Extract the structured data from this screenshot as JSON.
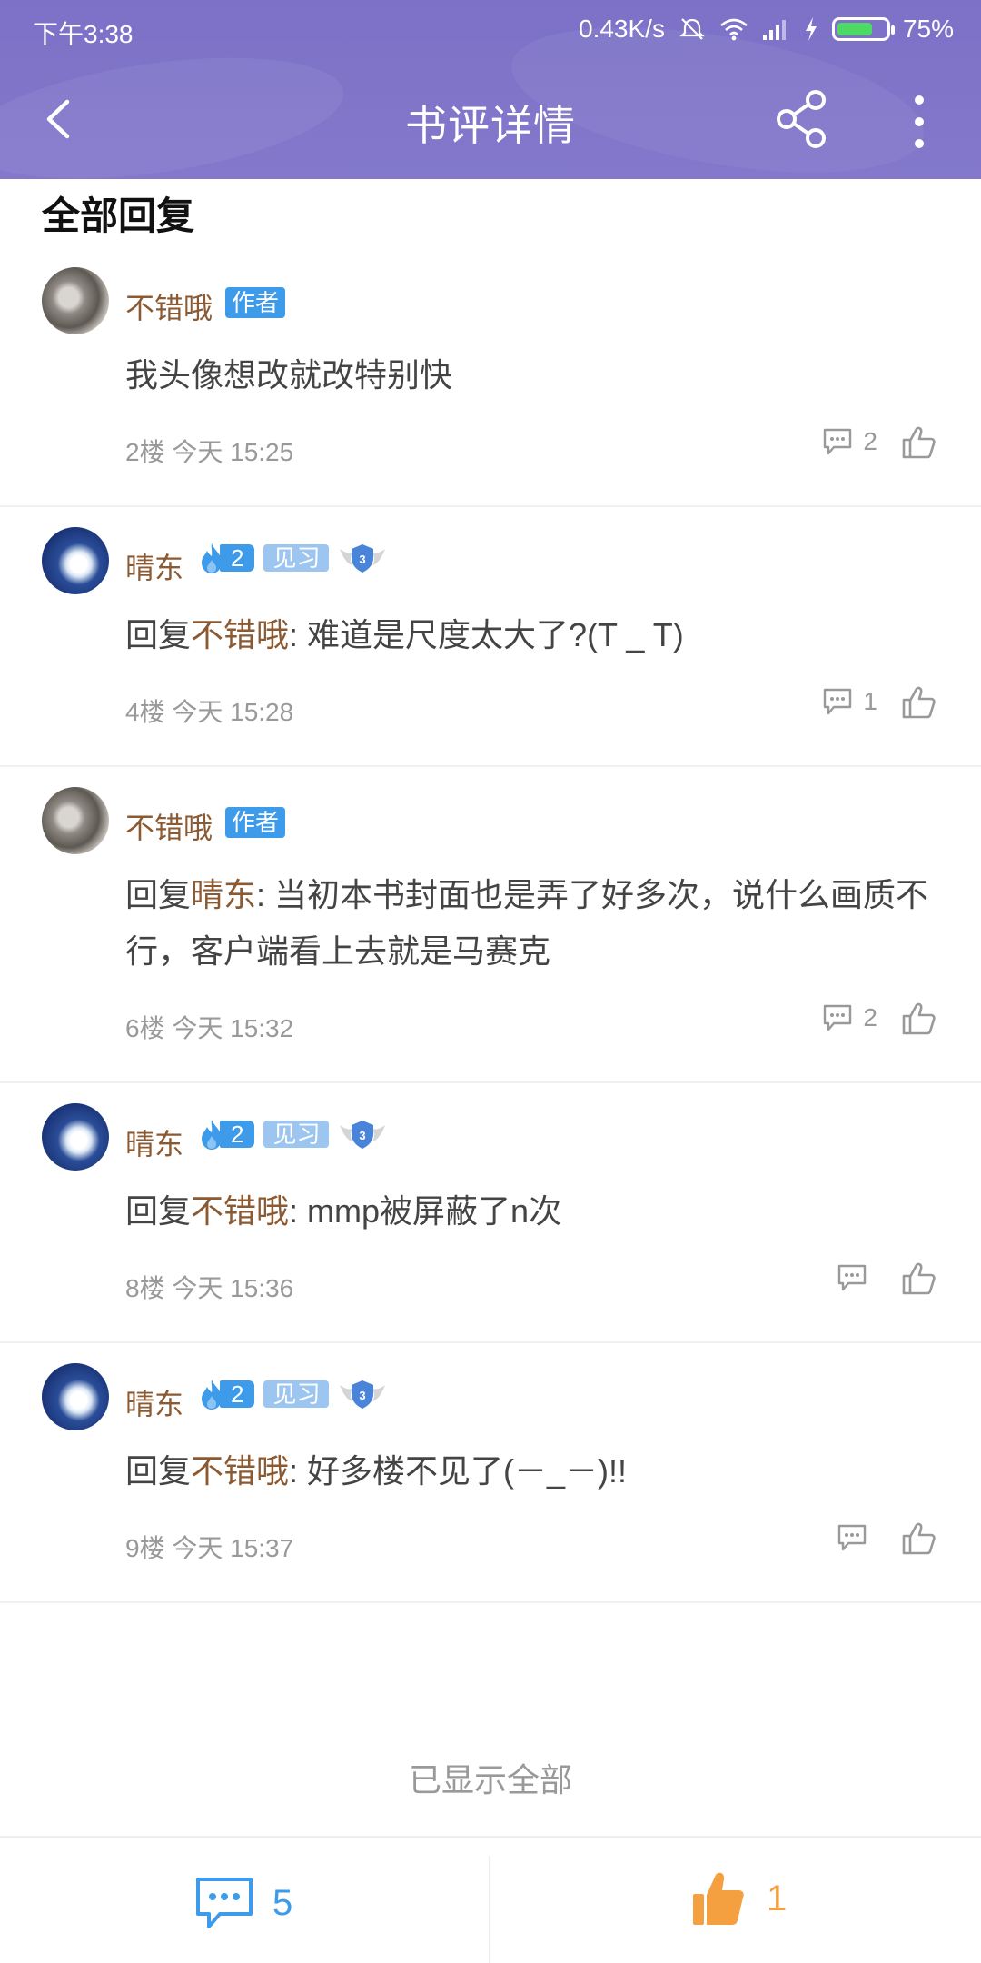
{
  "status_bar": {
    "time": "下午3:38",
    "net_speed": "0.43K/s",
    "battery": "75%",
    "battery_level": 0.75
  },
  "nav": {
    "title": "书评详情",
    "back_icon": "chevron-left-icon",
    "share_icon": "share-icon",
    "more_icon": "more-vertical-icon"
  },
  "section_title": "全部回复",
  "author_badge": "作者",
  "fire_level": "2",
  "jx_label": "见习",
  "shield_level": "3",
  "comments": [
    {
      "user": "不错哦",
      "is_author": true,
      "reply_prefix": "",
      "reply_to": "",
      "reply_colon": "",
      "text": "我头像想改就改特别快",
      "floor": "2楼 今天 15:25",
      "reply_count": "2"
    },
    {
      "user": "晴东",
      "is_author": false,
      "reply_prefix": "回复",
      "reply_to": "不错哦",
      "reply_colon": ": ",
      "text": "难道是尺度太大了?(T _ T)",
      "floor": "4楼 今天 15:28",
      "reply_count": "1"
    },
    {
      "user": "不错哦",
      "is_author": true,
      "reply_prefix": "回复",
      "reply_to": "晴东",
      "reply_colon": ": ",
      "text": "当初本书封面也是弄了好多次，说什么画质不行，客户端看上去就是马赛克",
      "floor": "6楼 今天 15:32",
      "reply_count": "2"
    },
    {
      "user": "晴东",
      "is_author": false,
      "reply_prefix": "回复",
      "reply_to": "不错哦",
      "reply_colon": ": ",
      "text": "mmp被屏蔽了n次",
      "floor": "8楼 今天 15:36",
      "reply_count": ""
    },
    {
      "user": "晴东",
      "is_author": false,
      "reply_prefix": "回复",
      "reply_to": "不错哦",
      "reply_colon": ": ",
      "text": "好多楼不见了(－_－)!!",
      "floor": "9楼 今天 15:37",
      "reply_count": ""
    }
  ],
  "end_text": "已显示全部",
  "bottom_bar": {
    "comment_count": "5",
    "like_count": "1"
  },
  "colors": {
    "header_bg": "#7d71c7",
    "username": "#8b5a32",
    "accent_blue": "#3e9be9",
    "like_orange": "#f5a040"
  }
}
